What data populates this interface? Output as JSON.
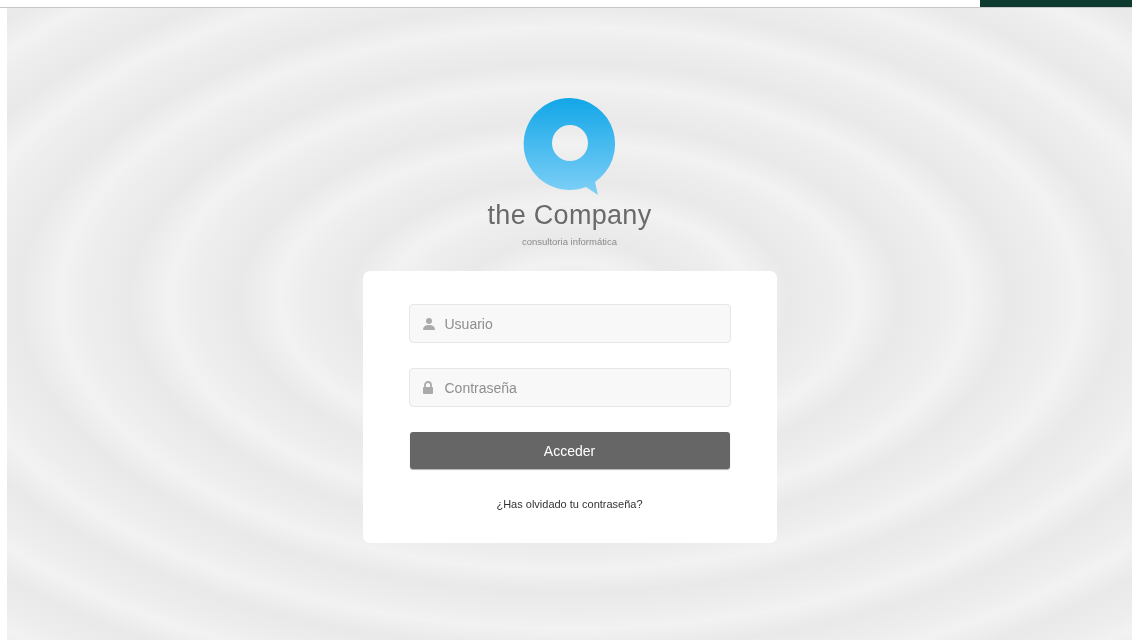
{
  "brand": {
    "name": "the Company",
    "tagline": "consultoria informática"
  },
  "login": {
    "fields": [
      {
        "kind": "user",
        "placeholder": "Usuario"
      },
      {
        "kind": "password",
        "placeholder": "Contraseña"
      }
    ],
    "submit": "Acceder",
    "forgot_link": "¿Has olvidado tu contraseña?"
  }
}
